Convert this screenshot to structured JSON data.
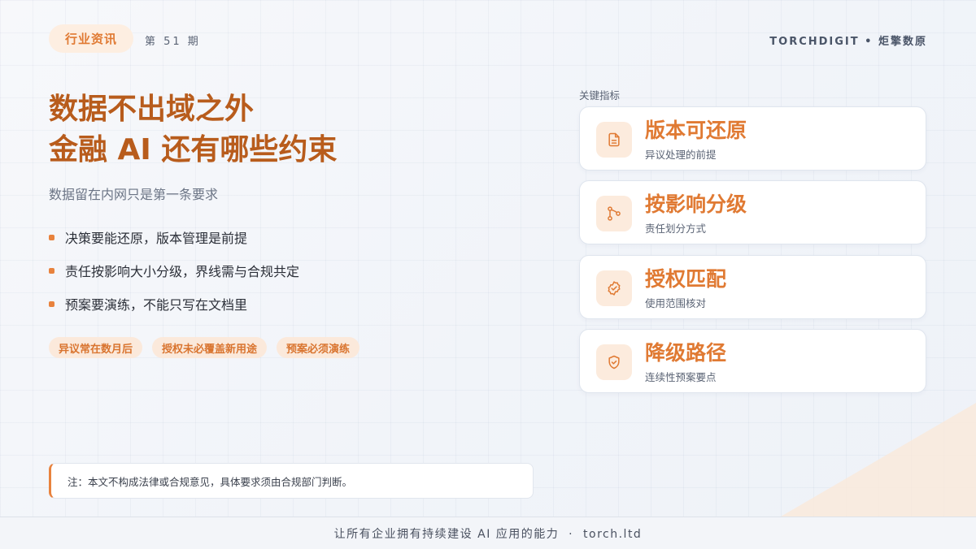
{
  "header": {
    "tag": "行业资讯",
    "issue": "第 51 期",
    "brand": "TORCHDIGIT • 炬擎数原"
  },
  "main": {
    "title_line1": "数据不出域之外",
    "title_line2": "金融 AI 还有哪些约束",
    "subtitle": "数据留在内网只是第一条要求",
    "bullets": [
      {
        "text": "决策要能还原，版本管理是前提"
      },
      {
        "text": "责任按影响大小分级，界线需与合规共定"
      },
      {
        "text": "预案要演练，不能只写在文档里"
      }
    ],
    "chips": [
      {
        "text": "异议常在数月后"
      },
      {
        "text": "授权未必覆盖新用途"
      },
      {
        "text": "预案必须演练"
      }
    ],
    "note": "注：本文不构成法律或合规意见，具体要求须由合规部门判断。"
  },
  "metrics": {
    "label": "关键指标",
    "cards": [
      {
        "title": "版本可还原",
        "subtitle": "异议处理的前提",
        "icon": "document-icon"
      },
      {
        "title": "按影响分级",
        "subtitle": "责任划分方式",
        "icon": "branch-icon"
      },
      {
        "title": "授权匹配",
        "subtitle": "使用范围核对",
        "icon": "badge-check-icon"
      },
      {
        "title": "降级路径",
        "subtitle": "连续性预案要点",
        "icon": "shield-check-icon"
      }
    ]
  },
  "footer": {
    "text": "让所有企业拥有持续建设 AI 应用的能力  ·  torch.ltd"
  },
  "colors": {
    "accent": "#e07a33",
    "title": "#b85c1c",
    "chip_bg": "#fbe9db"
  }
}
